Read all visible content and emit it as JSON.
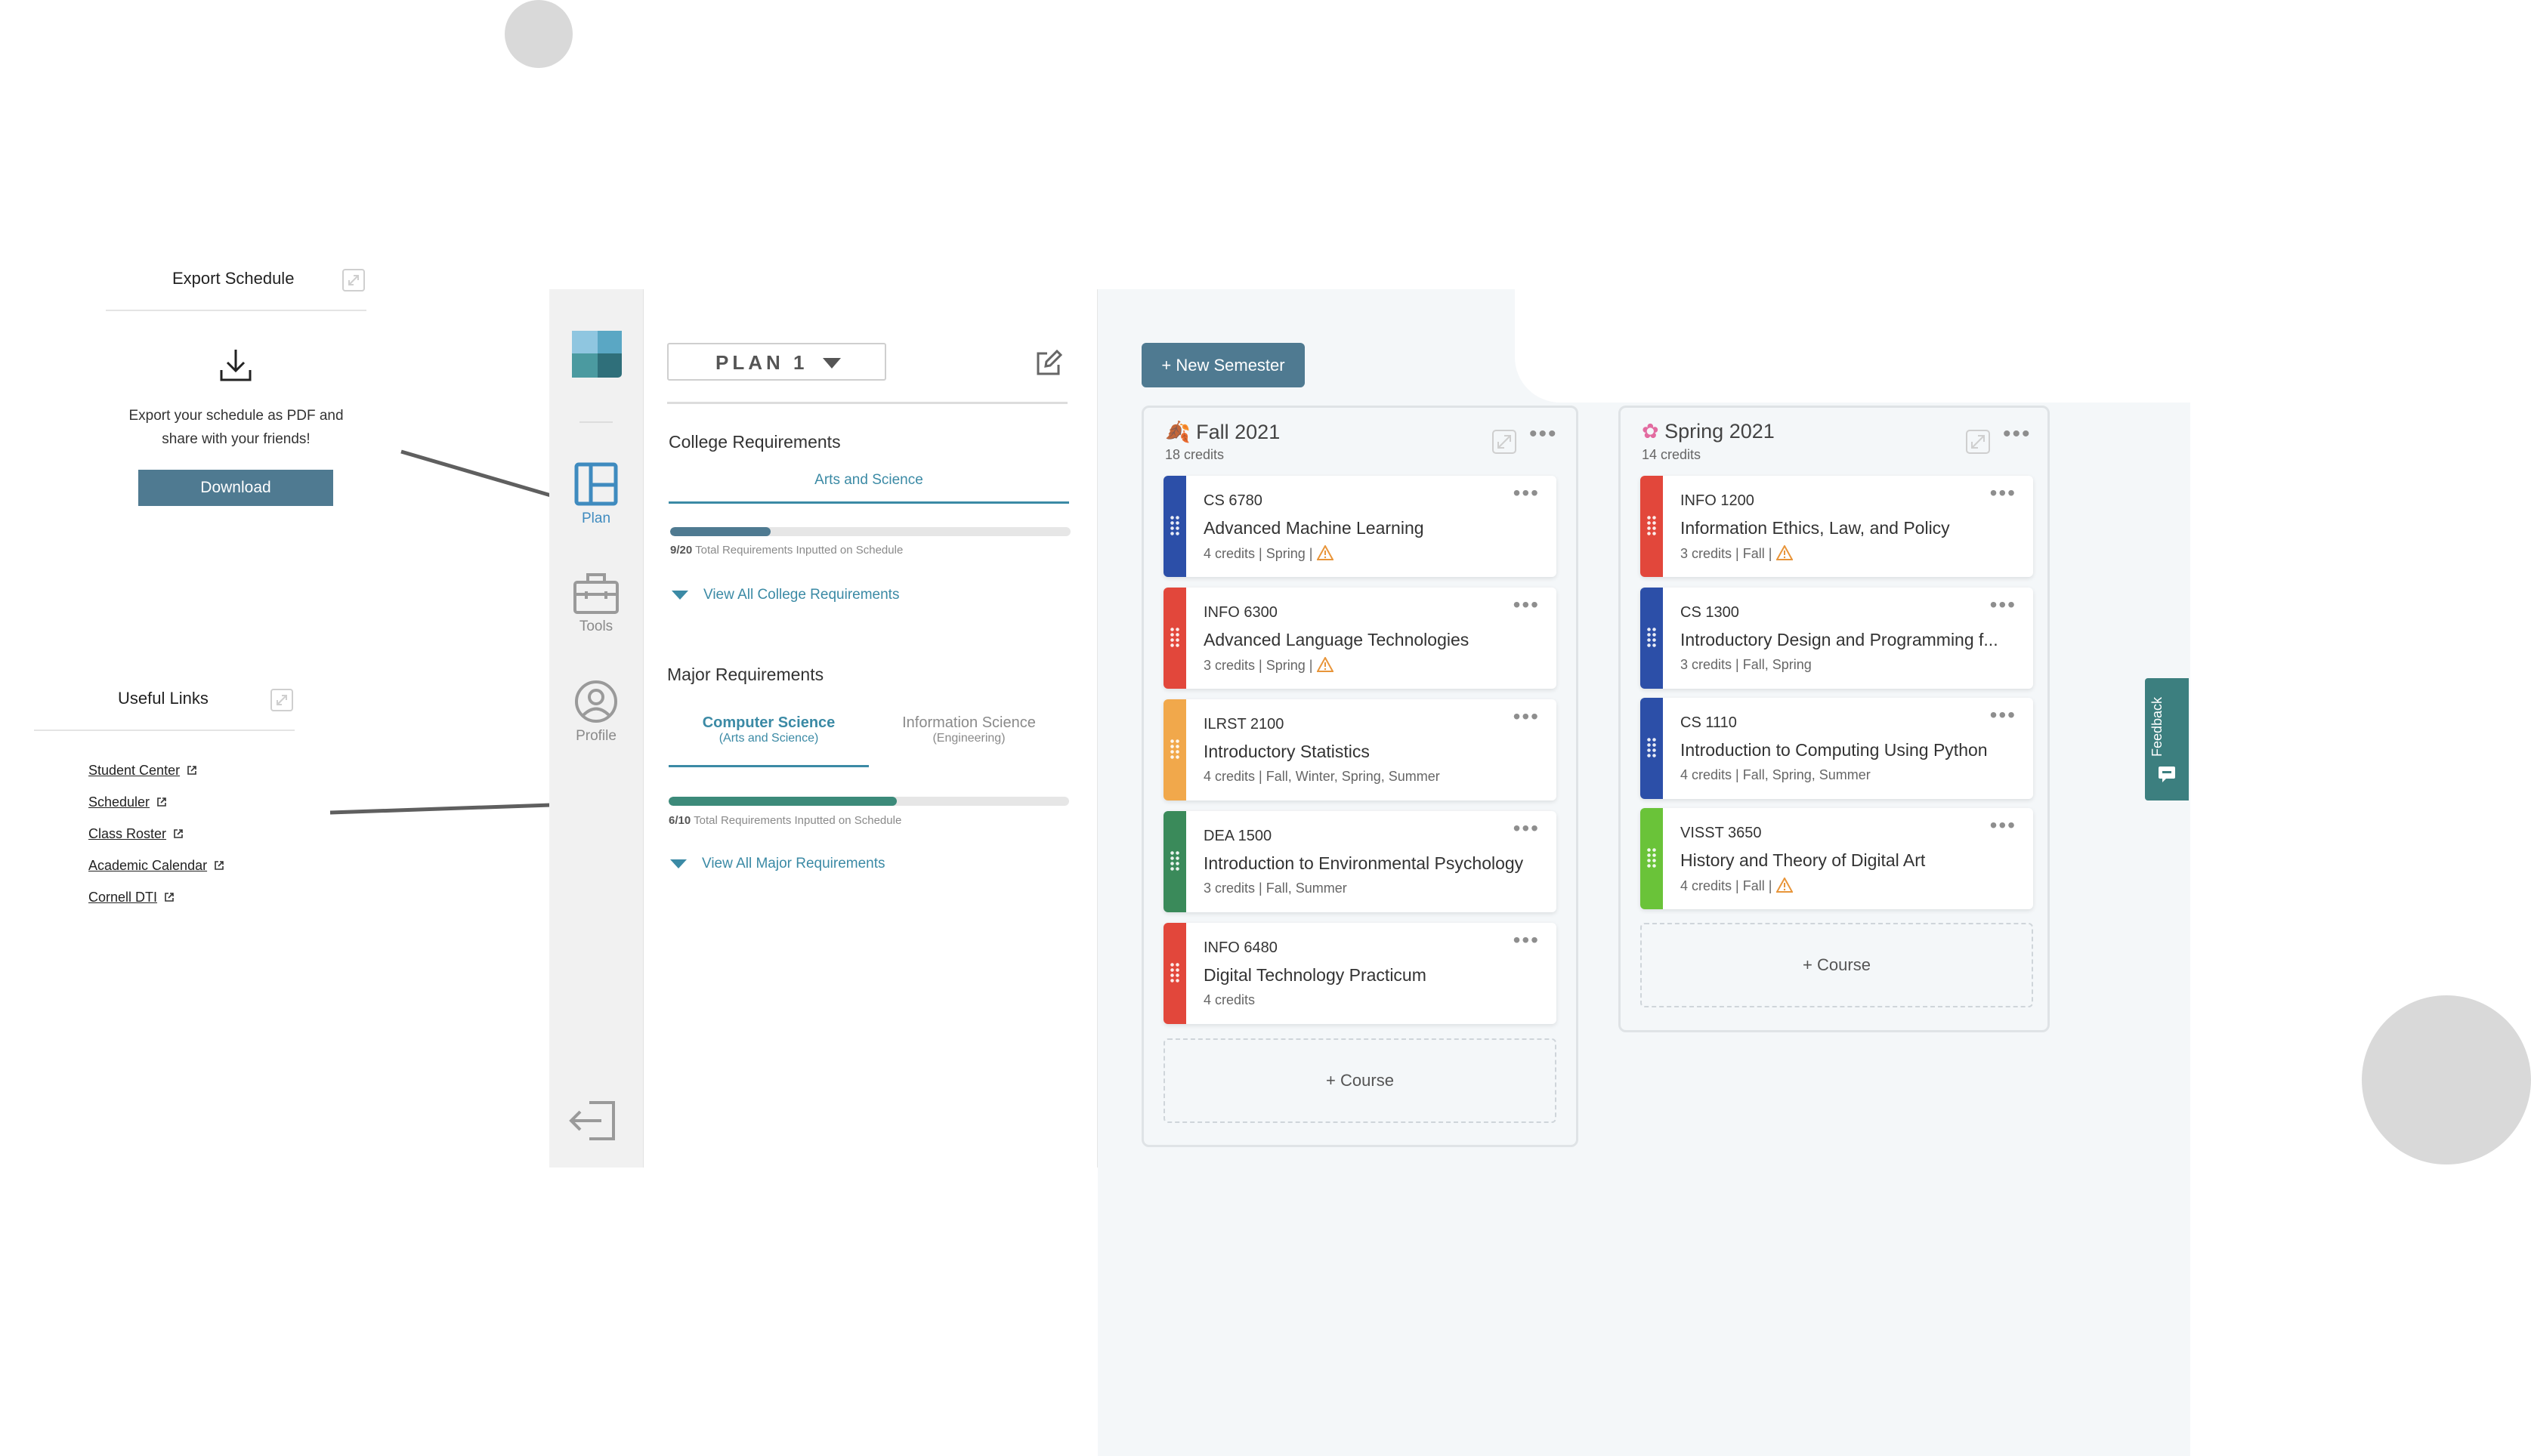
{
  "export_card": {
    "title": "Export Schedule",
    "description_line1": "Export your schedule as PDF and",
    "description_line2": "share with your friends!",
    "download_label": "Download"
  },
  "links_card": {
    "title": "Useful Links",
    "items": [
      "Student Center",
      "Scheduler",
      "Class Roster",
      "Academic Calendar",
      "Cornell DTI"
    ]
  },
  "nav": {
    "items": [
      {
        "label": "Plan",
        "icon": "plan-icon",
        "active": true
      },
      {
        "label": "Tools",
        "icon": "toolbox-icon",
        "active": false
      },
      {
        "label": "Profile",
        "icon": "profile-icon",
        "active": false
      }
    ]
  },
  "requirements": {
    "plan_name": "PLAN 1",
    "college": {
      "title": "College Requirements",
      "tab": "Arts and Science",
      "progress_count": "9/20",
      "progress_text": "Total Requirements Inputted on Schedule",
      "progress_fraction": 0.25,
      "view_all": "View All College Requirements"
    },
    "major": {
      "title": "Major Requirements",
      "tabs": [
        {
          "name": "Computer Science",
          "sub": "(Arts and Science)",
          "active": true
        },
        {
          "name": "Information Science",
          "sub": "(Engineering)",
          "active": false
        }
      ],
      "progress_count": "6/10",
      "progress_text": "Total Requirements Inputted on Schedule",
      "progress_fraction": 0.57,
      "view_all": "View All Major Requirements"
    }
  },
  "board": {
    "new_semester_label": "+ New Semester",
    "add_course_label": "+ Course",
    "semesters": [
      {
        "title": "Fall 2021",
        "credits": "18 credits",
        "courses": [
          {
            "code": "CS 6780",
            "name": "Advanced Machine Learning",
            "meta": "4 credits | Spring |",
            "warning": true,
            "color": "#2c4fa8"
          },
          {
            "code": "INFO 6300",
            "name": "Advanced Language Technologies",
            "meta": "3 credits | Spring |",
            "warning": true,
            "color": "#e2473b"
          },
          {
            "code": "ILRST 2100",
            "name": "Introductory Statistics",
            "meta": "4 credits | Fall, Winter, Spring, Summer",
            "warning": false,
            "color": "#f1a84b"
          },
          {
            "code": "DEA 1500",
            "name": "Introduction to Environmental Psychology",
            "meta": "3 credits | Fall, Summer",
            "warning": false,
            "color": "#3a8a5a"
          },
          {
            "code": "INFO 6480",
            "name": "Digital Technology Practicum",
            "meta": "4 credits",
            "warning": false,
            "color": "#e2473b"
          }
        ]
      },
      {
        "title": "Spring 2021",
        "credits": "14 credits",
        "courses": [
          {
            "code": "INFO 1200",
            "name": "Information Ethics, Law, and Policy",
            "meta": "3 credits | Fall |",
            "warning": true,
            "color": "#e2473b"
          },
          {
            "code": "CS 1300",
            "name": "Introductory Design and Programming f...",
            "meta": "3 credits | Fall, Spring",
            "warning": false,
            "color": "#2c4fa8"
          },
          {
            "code": "CS 1110",
            "name": "Introduction to Computing Using Python",
            "meta": "4 credits | Fall, Spring, Summer",
            "warning": false,
            "color": "#2c4fa8"
          },
          {
            "code": "VISST 3650",
            "name": "History and Theory of Digital Art",
            "meta": "4 credits | Fall |",
            "warning": true,
            "color": "#6ac339"
          }
        ]
      }
    ]
  },
  "feedback_label": "Feedback",
  "colors": {
    "accent": "#4f7a91",
    "teal": "#3b8aa5",
    "progress_college": "#4f7a91",
    "progress_major": "#3c8a7a",
    "warning": "#e8953a"
  }
}
